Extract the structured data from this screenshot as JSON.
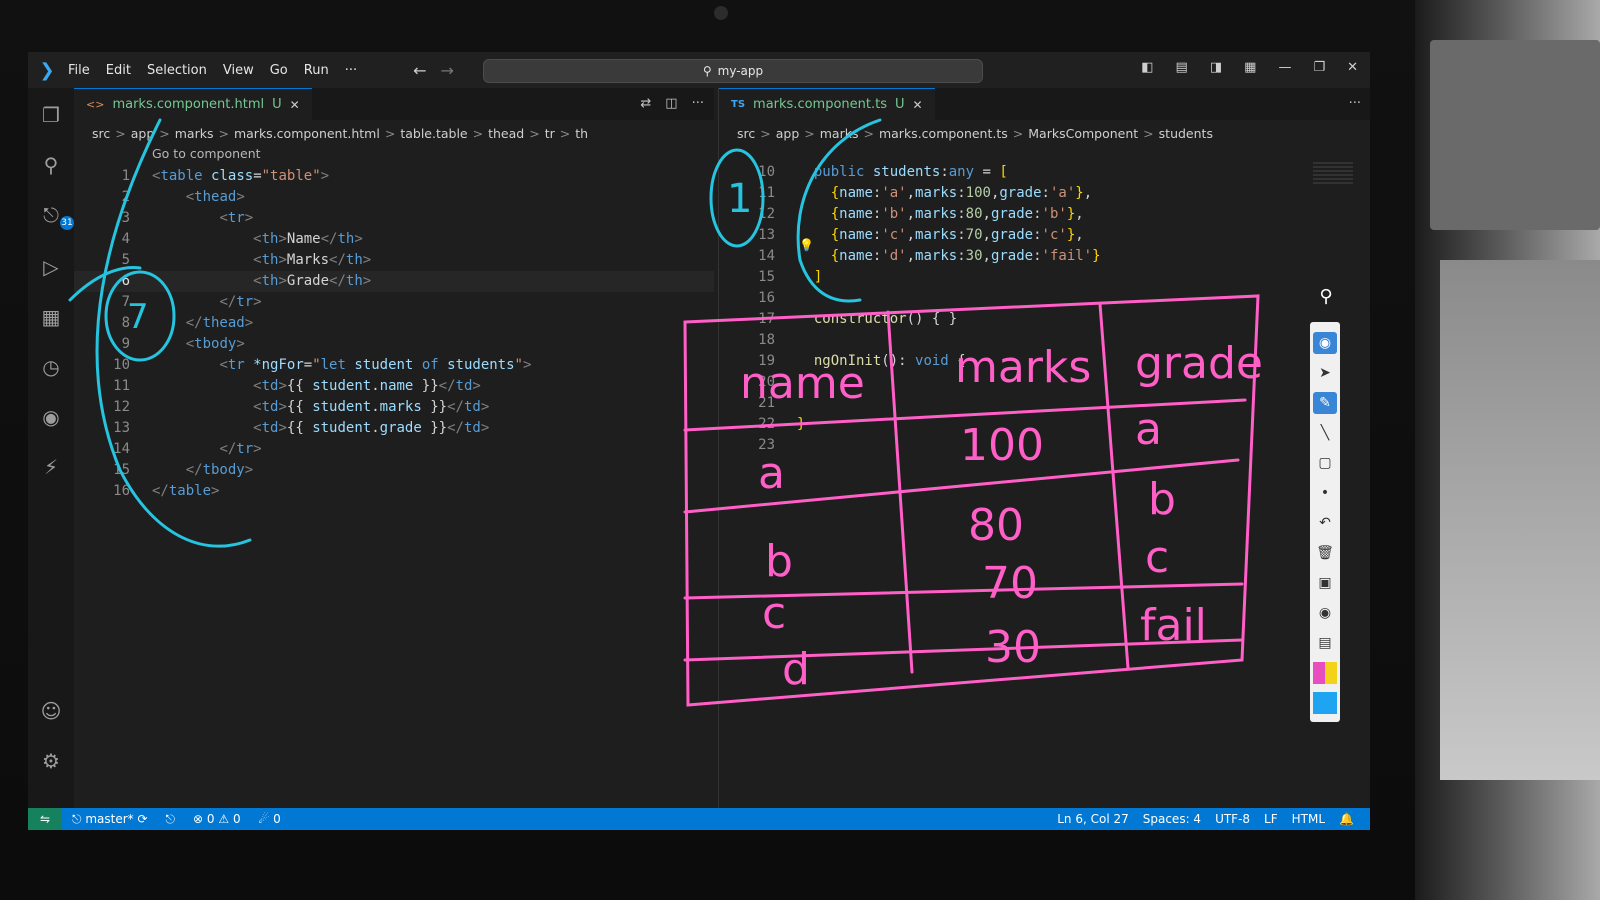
{
  "titlebar": {
    "menu": [
      "File",
      "Edit",
      "Selection",
      "View",
      "Go",
      "Run",
      "···"
    ],
    "search": "my-app"
  },
  "activity": {
    "scm_badge": "31"
  },
  "left_editor": {
    "tab": {
      "name": "marks.component.html",
      "status": "U"
    },
    "breadcrumb": [
      "src",
      "app",
      "marks",
      "marks.component.html",
      "table.table",
      "thead",
      "tr",
      "th"
    ],
    "codelens": "Go to component",
    "current_line": 6,
    "lines": [
      {
        "n": "1",
        "html": "<span class='t-br'>&lt;</span><span class='t-tag'>table</span> <span class='t-attr'>class</span>=<span class='t-str'>\"table\"</span><span class='t-br'>&gt;</span>"
      },
      {
        "n": "2",
        "html": "    <span class='t-br'>&lt;</span><span class='t-tag'>thead</span><span class='t-br'>&gt;</span>"
      },
      {
        "n": "3",
        "html": "        <span class='t-br'>&lt;</span><span class='t-tag'>tr</span><span class='t-br'>&gt;</span>"
      },
      {
        "n": "4",
        "html": "            <span class='t-br'>&lt;</span><span class='t-tag'>th</span><span class='t-br'>&gt;</span>Name<span class='t-br'>&lt;/</span><span class='t-tag'>th</span><span class='t-br'>&gt;</span>"
      },
      {
        "n": "5",
        "html": "            <span class='t-br'>&lt;</span><span class='t-tag'>th</span><span class='t-br'>&gt;</span>Marks<span class='t-br'>&lt;/</span><span class='t-tag'>th</span><span class='t-br'>&gt;</span>"
      },
      {
        "n": "6",
        "html": "            <span class='t-br'>&lt;</span><span class='t-tag'>th</span><span class='t-br'>&gt;</span>Grade<span class='t-br'>&lt;/</span><span class='t-tag'>th</span><span class='t-br'>&gt;</span>"
      },
      {
        "n": "7",
        "html": "        <span class='t-br'>&lt;/</span><span class='t-tag'>tr</span><span class='t-br'>&gt;</span>"
      },
      {
        "n": "8",
        "html": "    <span class='t-br'>&lt;/</span><span class='t-tag'>thead</span><span class='t-br'>&gt;</span>"
      },
      {
        "n": "9",
        "html": "    <span class='t-br'>&lt;</span><span class='t-tag'>tbody</span><span class='t-br'>&gt;</span>"
      },
      {
        "n": "10",
        "html": "        <span class='t-br'>&lt;</span><span class='t-tag'>tr</span> <span class='t-attr'>*ngFor</span>=<span class='t-str'>\"</span><span class='t-kw'>let</span> <span class='t-prop'>student</span> <span class='t-kw'>of</span> <span class='t-prop'>students</span><span class='t-str'>\"</span><span class='t-br'>&gt;</span>"
      },
      {
        "n": "11",
        "html": "            <span class='t-br'>&lt;</span><span class='t-tag'>td</span><span class='t-br'>&gt;</span>{{ <span class='t-prop'>student</span>.<span class='t-prop'>name</span> }}<span class='t-br'>&lt;/</span><span class='t-tag'>td</span><span class='t-br'>&gt;</span>"
      },
      {
        "n": "12",
        "html": "            <span class='t-br'>&lt;</span><span class='t-tag'>td</span><span class='t-br'>&gt;</span>{{ <span class='t-prop'>student</span>.<span class='t-prop'>marks</span> }}<span class='t-br'>&lt;/</span><span class='t-tag'>td</span><span class='t-br'>&gt;</span>"
      },
      {
        "n": "13",
        "html": "            <span class='t-br'>&lt;</span><span class='t-tag'>td</span><span class='t-br'>&gt;</span>{{ <span class='t-prop'>student</span>.<span class='t-prop'>grade</span> }}<span class='t-br'>&lt;/</span><span class='t-tag'>td</span><span class='t-br'>&gt;</span>"
      },
      {
        "n": "14",
        "html": "        <span class='t-br'>&lt;/</span><span class='t-tag'>tr</span><span class='t-br'>&gt;</span>"
      },
      {
        "n": "15",
        "html": "    <span class='t-br'>&lt;/</span><span class='t-tag'>tbody</span><span class='t-br'>&gt;</span>"
      },
      {
        "n": "16",
        "html": "<span class='t-br'>&lt;/</span><span class='t-tag'>table</span><span class='t-br'>&gt;</span>"
      }
    ]
  },
  "right_editor": {
    "tab": {
      "name": "marks.component.ts",
      "status": "U"
    },
    "breadcrumb": [
      "src",
      "app",
      "marks",
      "marks.component.ts",
      "MarksComponent",
      "students"
    ],
    "lines": [
      {
        "n": "10",
        "html": "  <span class='t-kw'>public</span> <span class='t-prop'>students</span>:<span class='t-tag'>any</span> = <span class='t-punc'>[</span>"
      },
      {
        "n": "11",
        "html": "    <span class='t-punc'>{</span><span class='t-prop'>name</span>:<span class='t-str'>'a'</span>,<span class='t-prop'>marks</span>:<span class='t-num'>100</span>,<span class='t-prop'>grade</span>:<span class='t-str'>'a'</span><span class='t-punc'>}</span>,"
      },
      {
        "n": "12",
        "html": "    <span class='t-punc'>{</span><span class='t-prop'>name</span>:<span class='t-str'>'b'</span>,<span class='t-prop'>marks</span>:<span class='t-num'>80</span>,<span class='t-prop'>grade</span>:<span class='t-str'>'b'</span><span class='t-punc'>}</span>,"
      },
      {
        "n": "13",
        "html": "    <span class='t-punc'>{</span><span class='t-prop'>name</span>:<span class='t-str'>'c'</span>,<span class='t-prop'>marks</span>:<span class='t-num'>70</span>,<span class='t-prop'>grade</span>:<span class='t-str'>'c'</span><span class='t-punc'>}</span>,"
      },
      {
        "n": "14",
        "html": "    <span class='t-punc'>{</span><span class='t-prop'>name</span>:<span class='t-str'>'d'</span>,<span class='t-prop'>marks</span>:<span class='t-num'>30</span>,<span class='t-prop'>grade</span>:<span class='t-str'>'fail'</span><span class='t-punc'>}</span>"
      },
      {
        "n": "15",
        "html": "  <span class='t-punc'>]</span>"
      },
      {
        "n": "16",
        "html": ""
      },
      {
        "n": "17",
        "html": "  <span class='t-fn'>constructor</span>() { }"
      },
      {
        "n": "18",
        "html": ""
      },
      {
        "n": "19",
        "html": "  <span class='t-fn'>ngOnInit</span>(): <span class='t-tag'>void</span> {"
      },
      {
        "n": "20",
        "html": ""
      },
      {
        "n": "21",
        "html": ""
      },
      {
        "n": "22",
        "html": "<span class='t-punc'>}</span>"
      },
      {
        "n": "23",
        "html": ""
      }
    ]
  },
  "statusbar": {
    "branch": "master*",
    "errors": "0",
    "warnings": "0",
    "ports": "0",
    "cursor": "Ln 6, Col 27",
    "spaces": "Spaces: 4",
    "encoding": "UTF-8",
    "eol": "LF",
    "language": "HTML"
  },
  "ink_table": {
    "headers": [
      "name",
      "marks",
      "grade"
    ],
    "rows": [
      [
        "a",
        "100",
        "a"
      ],
      [
        "b",
        "80",
        "b"
      ],
      [
        "c",
        "70",
        "c"
      ],
      [
        "d",
        "30",
        "fail"
      ]
    ],
    "color": "#ff5fc7"
  },
  "ink_circles": [
    "7",
    "1"
  ],
  "colors": {
    "accent": "#0078d4",
    "remote": "#16825d",
    "ink_blue": "#27c4e0"
  }
}
